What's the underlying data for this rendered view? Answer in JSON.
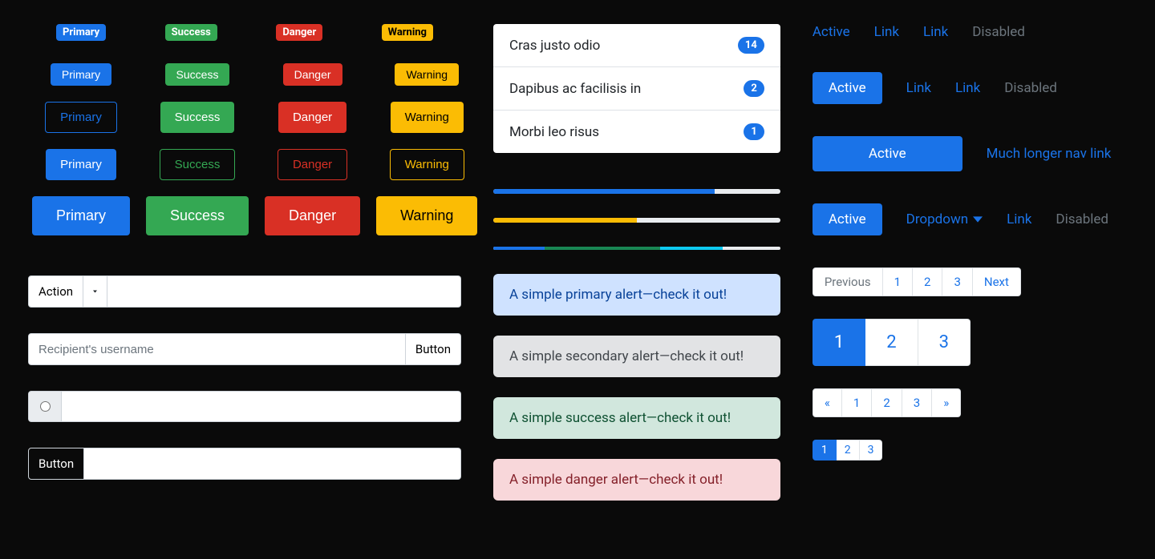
{
  "badges": {
    "primary": "Primary",
    "success": "Success",
    "danger": "Danger",
    "warning": "Warning"
  },
  "buttons": {
    "primary": "Primary",
    "success": "Success",
    "danger": "Danger",
    "warning": "Warning"
  },
  "input_groups": {
    "action_label": "Action",
    "recipient_placeholder": "Recipient's username",
    "button_label": "Button"
  },
  "list_group": [
    {
      "text": "Cras justo odio",
      "count": "14"
    },
    {
      "text": "Dapibus ac facilisis in",
      "count": "2"
    },
    {
      "text": "Morbi leo risus",
      "count": "1"
    }
  ],
  "progress": {
    "single_primary": 77,
    "single_warning": 50,
    "multi": [
      {
        "color": "primary",
        "pct": 18
      },
      {
        "color": "success",
        "pct": 40
      },
      {
        "color": "info",
        "pct": 22
      }
    ]
  },
  "alerts": {
    "primary": "A simple primary alert—check it out!",
    "secondary": "A simple secondary alert—check it out!",
    "success": "A simple success alert—check it out!",
    "danger": "A simple danger alert—check it out!"
  },
  "navs": {
    "active": "Active",
    "link": "Link",
    "disabled": "Disabled",
    "long": "Much longer nav link",
    "dropdown": "Dropdown"
  },
  "pagination": {
    "previous": "Previous",
    "next": "Next",
    "p1": "1",
    "p2": "2",
    "p3": "3",
    "laquo": "«",
    "raquo": "»"
  }
}
